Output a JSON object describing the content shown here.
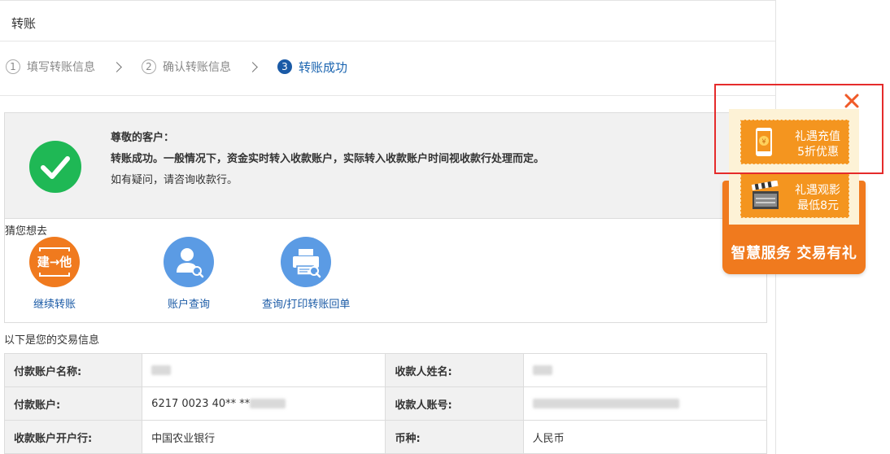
{
  "page": {
    "title": "转账"
  },
  "steps": [
    {
      "num": "1",
      "label": "填写转账信息"
    },
    {
      "num": "2",
      "label": "确认转账信息"
    },
    {
      "num": "3",
      "label": "转账成功"
    }
  ],
  "result": {
    "greeting": "尊敬的客户：",
    "message": "转账成功。一般情况下，资金实时转入收款账户，实际转入收款账户时间视收款行处理而定。",
    "note": "如有疑问，请咨询收款行。",
    "icon": "check-icon",
    "icon_color": "#1fb855"
  },
  "guess": {
    "title": "猜您想去",
    "items": [
      {
        "label": "继续转账",
        "icon": "transfer-icon",
        "icon_text": "建→他",
        "color": "#f07a1e"
      },
      {
        "label": "账户查询",
        "icon": "account-search-icon",
        "color": "#5b9be4"
      },
      {
        "label": "查询/打印转账回单",
        "icon": "printer-icon",
        "color": "#5b9be4"
      }
    ]
  },
  "trade": {
    "title": "以下是您的交易信息",
    "rows": [
      {
        "k1": "付款账户名称:",
        "v1": "",
        "k2": "收款人姓名:",
        "v2": ""
      },
      {
        "k1": "付款账户:",
        "v1": "6217 0023 40** **",
        "k2": "收款人账号:",
        "v2": ""
      },
      {
        "k1": "收款账户开户行:",
        "v1": "中国农业银行",
        "k2": "币种:",
        "v2": "人民币"
      }
    ]
  },
  "promo": {
    "recharge_line1": "礼遇充值",
    "recharge_line2": "5折优惠",
    "movie_line1": "礼遇观影",
    "movie_line2": "最低8元",
    "slogan": "智慧服务 交易有礼",
    "highlight_color": "#e52b2b",
    "accent_color": "#f07a1e"
  }
}
